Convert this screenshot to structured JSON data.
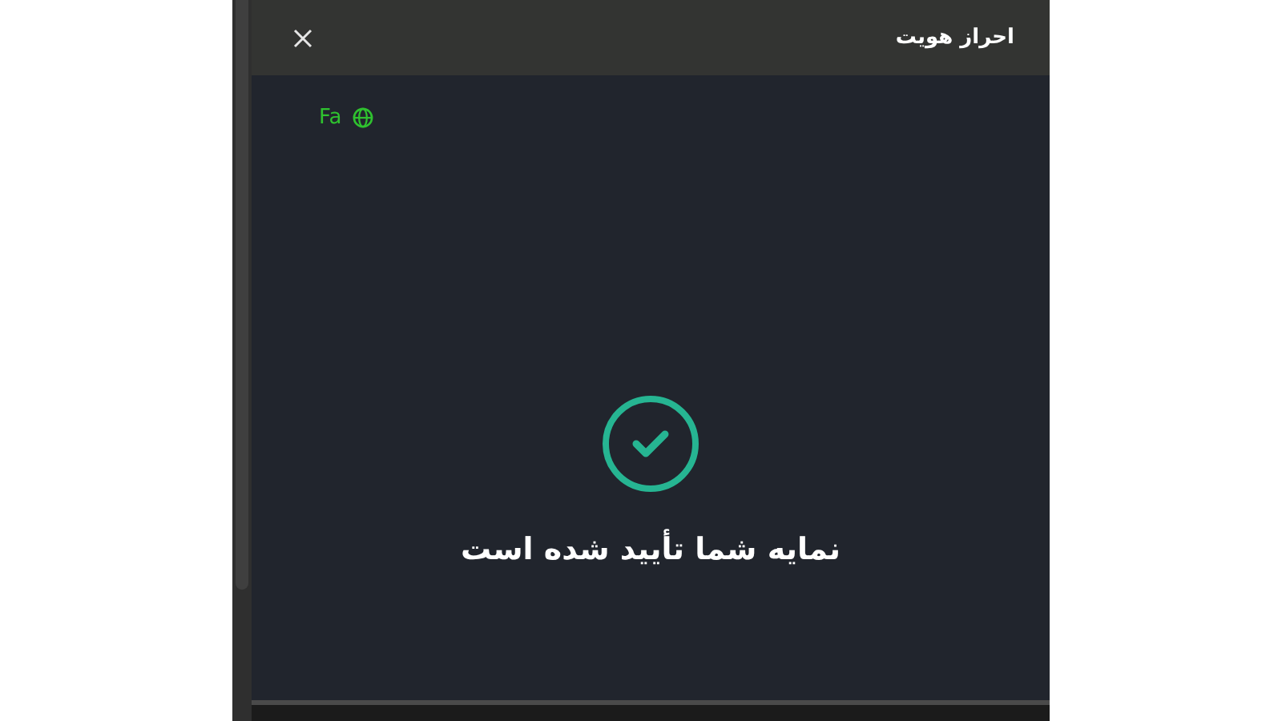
{
  "header": {
    "title": "احراز هویت"
  },
  "language": {
    "label": "Fa"
  },
  "status": {
    "kind": "success",
    "message": "نمایه شما تأیید شده است"
  }
}
